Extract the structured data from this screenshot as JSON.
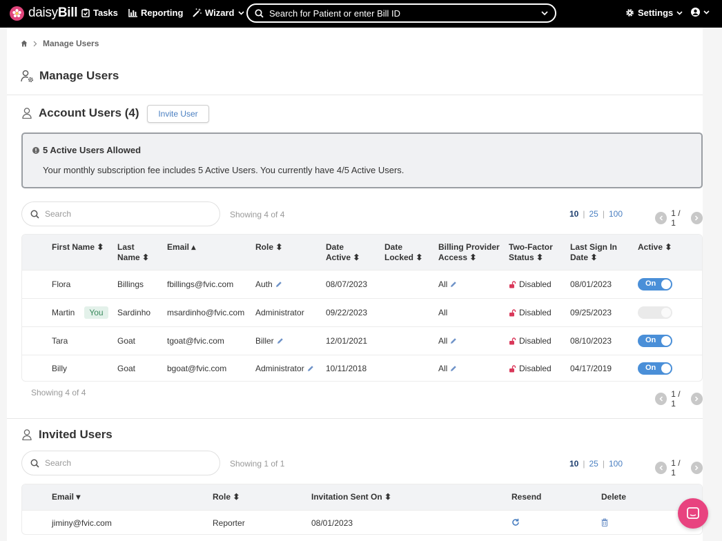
{
  "colors": {
    "brand": "#e0457b",
    "accent": "#4a8fd8",
    "topbar": "#000000",
    "link": "#4a7fc1"
  },
  "topbar": {
    "logo_prefix": "daisy",
    "logo_bold": "Bill",
    "tasks": "Tasks",
    "reporting": "Reporting",
    "wizard": "Wizard",
    "search_placeholder": "Search for Patient or enter Bill ID",
    "settings": "Settings"
  },
  "breadcrumb": {
    "current": "Manage Users"
  },
  "page_title": "Manage Users",
  "account_users": {
    "title": "Account Users (4)",
    "invite_button": "Invite User",
    "alert_title": "5 Active Users Allowed",
    "alert_body": "Your monthly subscription fee includes 5 Active Users. You currently have 4/5 Active Users.",
    "search_placeholder": "Search",
    "showing_top": "Showing 4 of 4",
    "showing_bottom": "Showing 4 of 4",
    "page_sizes": [
      "10",
      "25",
      "100"
    ],
    "page": "1 / 1",
    "headers": {
      "first_name": "First Name",
      "last_name_1": "Last",
      "last_name_2": "Name",
      "email": "Email",
      "role": "Role",
      "date_active_1": "Date",
      "date_active_2": "Active",
      "date_locked_1": "Date",
      "date_locked_2": "Locked",
      "billing_1": "Billing Provider",
      "billing_2": "Access",
      "twofactor_1": "Two-Factor",
      "twofactor_2": "Status",
      "last_sign_1": "Last Sign In",
      "last_sign_2": "Date",
      "active": "Active"
    },
    "rows": [
      {
        "first": "Flora",
        "you": "",
        "last": "Billings",
        "email": "fbillings@fvic.com",
        "role": "Auth",
        "date_active": "08/07/2023",
        "date_locked": "",
        "billing": "All",
        "twofactor": "Disabled",
        "last_sign": "08/01/2023",
        "active": "On"
      },
      {
        "first": "Martin",
        "you": "You",
        "last": "Sardinho",
        "email": "msardinho@fvic.com",
        "role": "Administrator",
        "date_active": "09/22/2023",
        "date_locked": "",
        "billing": "All",
        "twofactor": "Disabled",
        "last_sign": "09/25/2023",
        "active": ""
      },
      {
        "first": "Tara",
        "you": "",
        "last": "Goat",
        "email": "tgoat@fvic.com",
        "role": "Biller",
        "date_active": "12/01/2021",
        "date_locked": "",
        "billing": "All",
        "twofactor": "Disabled",
        "last_sign": "08/10/2023",
        "active": "On"
      },
      {
        "first": "Billy",
        "you": "",
        "last": "Goat",
        "email": "bgoat@fvic.com",
        "role": "Administrator",
        "date_active": "10/11/2018",
        "date_locked": "",
        "billing": "All",
        "twofactor": "Disabled",
        "last_sign": "04/17/2019",
        "active": "On"
      }
    ]
  },
  "invited_users": {
    "title": "Invited Users",
    "search_placeholder": "Search",
    "showing": "Showing 1 of 1",
    "page_sizes": [
      "10",
      "25",
      "100"
    ],
    "page": "1 / 1",
    "headers": {
      "email": "Email",
      "role": "Role",
      "sent_on": "Invitation Sent On",
      "resend": "Resend",
      "delete": "Delete"
    },
    "rows": [
      {
        "email": "jiminy@fvic.com",
        "role": "Reporter",
        "sent_on": "08/01/2023"
      }
    ]
  }
}
